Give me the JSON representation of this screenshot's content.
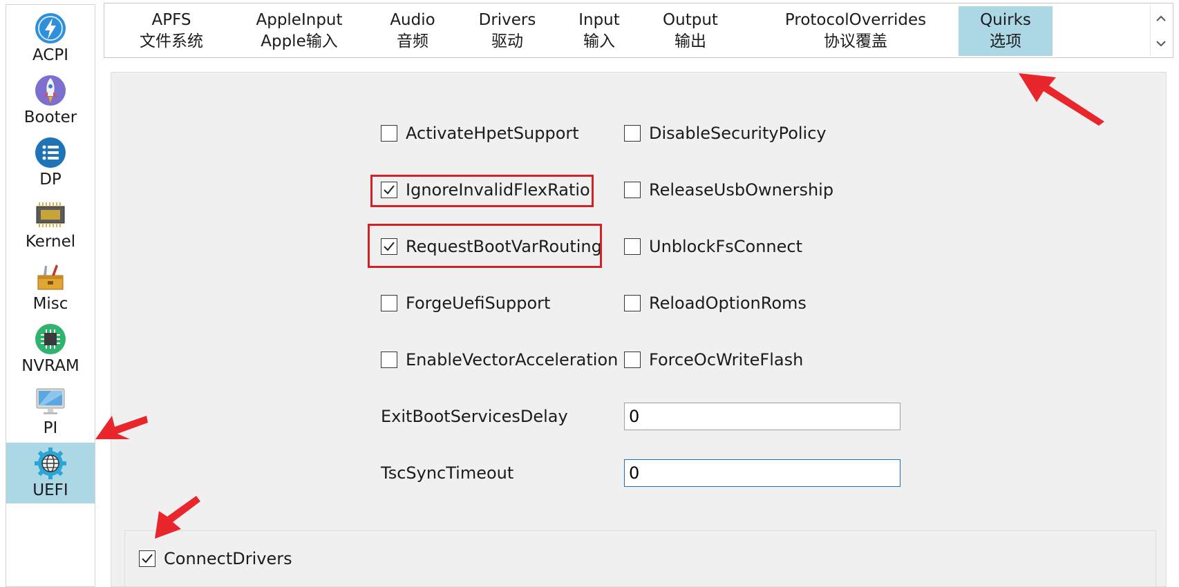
{
  "sidebar": {
    "items": [
      {
        "label": "ACPI",
        "icon": "lightning-icon"
      },
      {
        "label": "Booter",
        "icon": "rocket-icon"
      },
      {
        "label": "DP",
        "icon": "list-icon"
      },
      {
        "label": "Kernel",
        "icon": "chip-icon"
      },
      {
        "label": "Misc",
        "icon": "toolbox-icon"
      },
      {
        "label": "NVRAM",
        "icon": "memory-chip-icon"
      },
      {
        "label": "PI",
        "icon": "monitor-icon"
      },
      {
        "label": "UEFI",
        "icon": "globe-gear-icon"
      }
    ],
    "active": "UEFI"
  },
  "tabs": [
    {
      "en": "APFS",
      "zh": "文件系统"
    },
    {
      "en": "AppleInput",
      "zh": "Apple输入"
    },
    {
      "en": "Audio",
      "zh": "音频"
    },
    {
      "en": "Drivers",
      "zh": "驱动"
    },
    {
      "en": "Input",
      "zh": "输入"
    },
    {
      "en": "Output",
      "zh": "输出"
    },
    {
      "en": "ProtocolOverrides",
      "zh": "协议覆盖"
    },
    {
      "en": "Quirks",
      "zh": "选项"
    }
  ],
  "active_tab": "Quirks",
  "quirks": {
    "left": [
      {
        "label": "ActivateHpetSupport",
        "checked": false
      },
      {
        "label": "IgnoreInvalidFlexRatio",
        "checked": true
      },
      {
        "label": "RequestBootVarRouting",
        "checked": true
      },
      {
        "label": "ForgeUefiSupport",
        "checked": false
      },
      {
        "label": "EnableVectorAcceleration",
        "checked": false
      }
    ],
    "right": [
      {
        "label": "DisableSecurityPolicy",
        "checked": false
      },
      {
        "label": "ReleaseUsbOwnership",
        "checked": false
      },
      {
        "label": "UnblockFsConnect",
        "checked": false
      },
      {
        "label": "ReloadOptionRoms",
        "checked": false
      },
      {
        "label": "ForceOcWriteFlash",
        "checked": false
      }
    ],
    "exit_boot_services_delay": {
      "label": "ExitBootServicesDelay",
      "value": "0"
    },
    "tsc_sync_timeout": {
      "label": "TscSyncTimeout",
      "value": "0"
    }
  },
  "connect_drivers": {
    "label": "ConnectDrivers",
    "checked": true
  },
  "colors": {
    "active_bg": "#acd8e6",
    "highlight": "#d62027",
    "arrow": "#e8262b"
  }
}
